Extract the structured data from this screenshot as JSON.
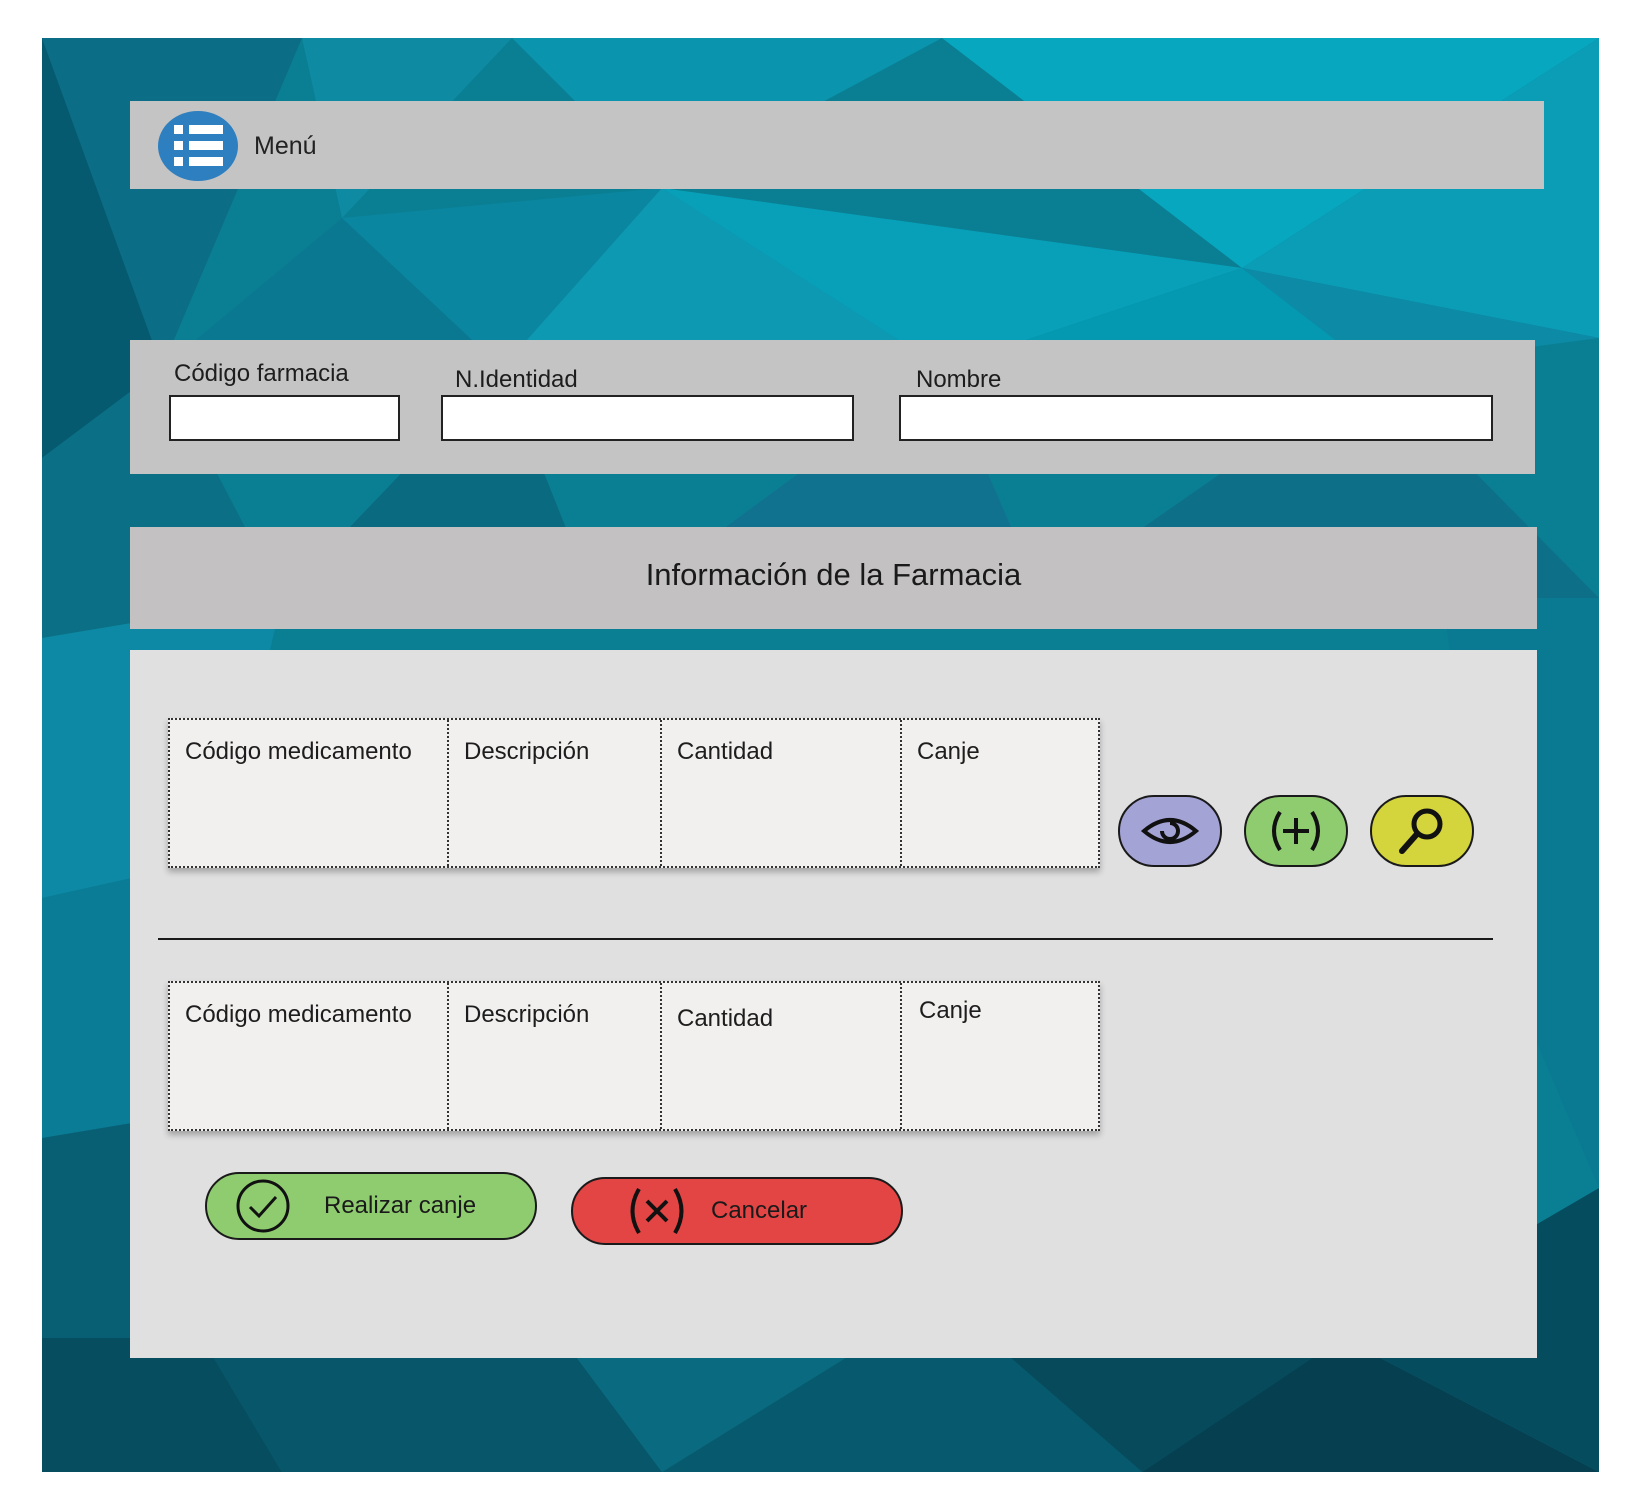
{
  "menu": {
    "label": "Menú",
    "icon": "list-menu-icon",
    "icon_color": "#2e7fbf"
  },
  "filters": {
    "pharmacy_code": {
      "label": "Código farmacia",
      "value": ""
    },
    "identity_number": {
      "label": "N.Identidad",
      "value": ""
    },
    "name": {
      "label": "Nombre",
      "value": ""
    }
  },
  "section_title": "Información de la Farmacia",
  "tables": [
    {
      "columns": [
        "Código medicamento",
        "Descripción",
        "Cantidad",
        "Canje"
      ]
    },
    {
      "columns": [
        "Código medicamento",
        "Descripción",
        "Cantidad",
        "Canje"
      ]
    }
  ],
  "action_buttons": [
    {
      "icon": "eye-icon",
      "color": "#a3a3d6"
    },
    {
      "icon": "plus-circle-icon",
      "color": "#8fcc70"
    },
    {
      "icon": "magnifier-icon",
      "color": "#d4d43c"
    }
  ],
  "buttons": {
    "redeem": {
      "label": "Realizar canje",
      "icon": "check-circle-icon",
      "color": "#8fcc70"
    },
    "cancel": {
      "label": "Cancelar",
      "icon": "x-circle-icon",
      "color": "#e34444"
    }
  },
  "colors": {
    "background_teal": "#0a7f93",
    "panel_gray": "#c4c4c4",
    "content_gray": "#e0e0e1"
  }
}
